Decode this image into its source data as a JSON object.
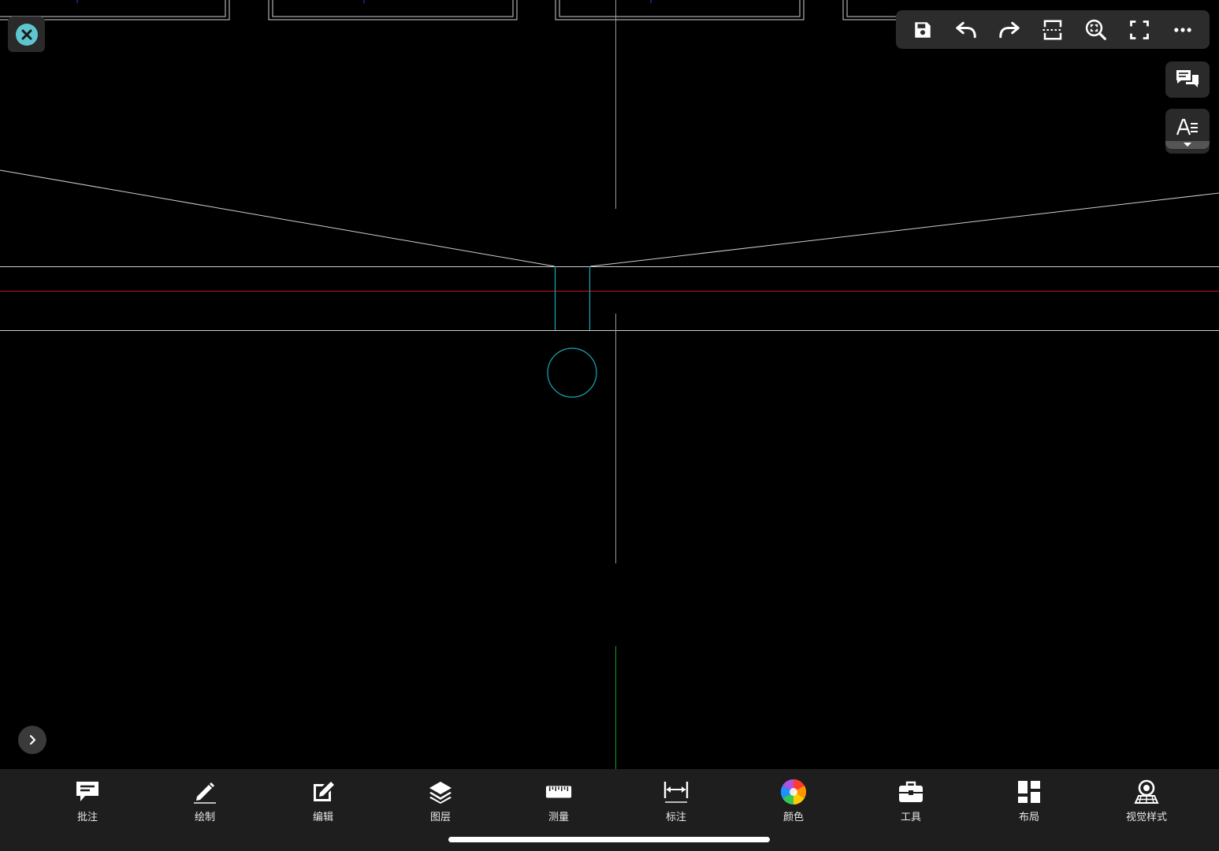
{
  "toolbar_top": {
    "buttons": [
      {
        "name": "save-button",
        "icon": "save-icon"
      },
      {
        "name": "undo-button",
        "icon": "undo-icon"
      },
      {
        "name": "redo-button",
        "icon": "redo-icon"
      },
      {
        "name": "section-button",
        "icon": "section-icon"
      },
      {
        "name": "zoom-extents-button",
        "icon": "zoom-extents-icon"
      },
      {
        "name": "fullscreen-button",
        "icon": "fullscreen-icon"
      },
      {
        "name": "more-button",
        "icon": "more-icon"
      }
    ]
  },
  "colors": {
    "accent": "#5ec6cf",
    "canvas_bg": "#000000",
    "bar_bg": "#1e1e1e",
    "cad_cyan": "#18a8b8",
    "cad_red": "#c01818",
    "cad_green": "#1aa01a",
    "cad_white": "#d8d8d8"
  },
  "bottom_tools": [
    {
      "label": "批注",
      "icon": "annotation-icon"
    },
    {
      "label": "绘制",
      "icon": "pencil-icon"
    },
    {
      "label": "编辑",
      "icon": "edit-icon"
    },
    {
      "label": "图层",
      "icon": "layers-icon"
    },
    {
      "label": "测量",
      "icon": "ruler-icon"
    },
    {
      "label": "标注",
      "icon": "dimension-icon"
    },
    {
      "label": "颜色",
      "icon": "color-wheel-icon"
    },
    {
      "label": "工具",
      "icon": "toolbox-icon"
    },
    {
      "label": "布局",
      "icon": "layout-icon"
    },
    {
      "label": "视觉样式",
      "icon": "visual-style-icon"
    }
  ]
}
